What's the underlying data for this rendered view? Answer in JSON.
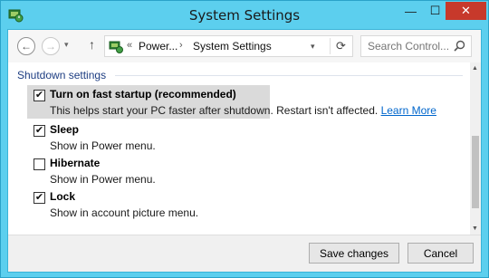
{
  "window": {
    "title": "System Settings",
    "minimize_glyph": "—",
    "maximize_glyph": "☐",
    "close_glyph": "✕"
  },
  "nav": {
    "back_glyph": "←",
    "forward_glyph": "→",
    "dropdown_glyph": "▾",
    "up_glyph": "↑",
    "breadcrumb_chevron": "«",
    "breadcrumb": [
      "Power...",
      "System Settings"
    ],
    "breadcrumb_separator": "›",
    "address_dropdown_glyph": "▾",
    "refresh_glyph": "⟳",
    "search_placeholder": "Search Control...",
    "search_value": ""
  },
  "section": {
    "heading": "Shutdown settings"
  },
  "options": [
    {
      "label": "Turn on fast startup (recommended)",
      "checked": true,
      "description": "This helps start your PC faster after shutdown. Restart isn't affected. ",
      "link": "Learn More"
    },
    {
      "label": "Sleep",
      "checked": true,
      "description": "Show in Power menu."
    },
    {
      "label": "Hibernate",
      "checked": false,
      "description": "Show in Power menu."
    },
    {
      "label": "Lock",
      "checked": true,
      "description": "Show in account picture menu."
    }
  ],
  "check_glyph": "✔",
  "scroll": {
    "up_glyph": "▲",
    "down_glyph": "▼"
  },
  "footer": {
    "save_label": "Save changes",
    "cancel_label": "Cancel"
  },
  "colors": {
    "frame": "#5ccfee",
    "close": "#c7392b",
    "heading": "#1d3d82",
    "link": "#0066cc"
  }
}
